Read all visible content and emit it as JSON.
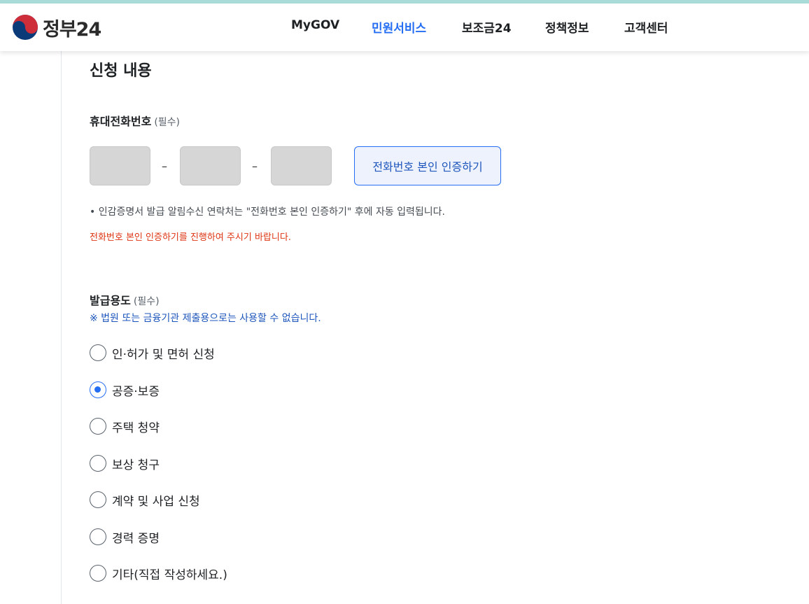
{
  "header": {
    "logo_text": "정부24",
    "nav": [
      {
        "label": "MyGOV",
        "active": false
      },
      {
        "label": "민원서비스",
        "active": true
      },
      {
        "label": "보조금24",
        "active": false
      },
      {
        "label": "정책정보",
        "active": false
      },
      {
        "label": "고객센터",
        "active": false
      }
    ]
  },
  "form": {
    "section_title": "신청 내용",
    "phone": {
      "label": "휴대전화번호",
      "required": "(필수)",
      "dash": "–",
      "fields": [
        "",
        "",
        ""
      ],
      "verify_button": "전화번호 본인 인증하기",
      "note": "• 인감증명서 발급 알림수신 연락처는 \"전화번호 본인 인증하기\" 후에 자동 입력됩니다.",
      "warning": "전화번호 본인 인증하기를 진행하여 주시기 바랍니다."
    },
    "purpose": {
      "label": "발급용도",
      "required": "(필수)",
      "notice": "※ 법원 또는 금융기관 제출용으로는 사용할 수 없습니다.",
      "options": [
        {
          "label": "인·허가 및 면허 신청",
          "checked": false
        },
        {
          "label": "공증·보증",
          "checked": true
        },
        {
          "label": "주택 청약",
          "checked": false
        },
        {
          "label": "보상 청구",
          "checked": false
        },
        {
          "label": "계약 및 사업 신청",
          "checked": false
        },
        {
          "label": "경력 증명",
          "checked": false
        },
        {
          "label": "기타(직접 작성하세요.)",
          "checked": false
        }
      ]
    }
  },
  "colors": {
    "accent": "#256ef4",
    "warning": "#de3412",
    "notice": "#1d56bc",
    "top_strip": "#a9dcd9"
  }
}
